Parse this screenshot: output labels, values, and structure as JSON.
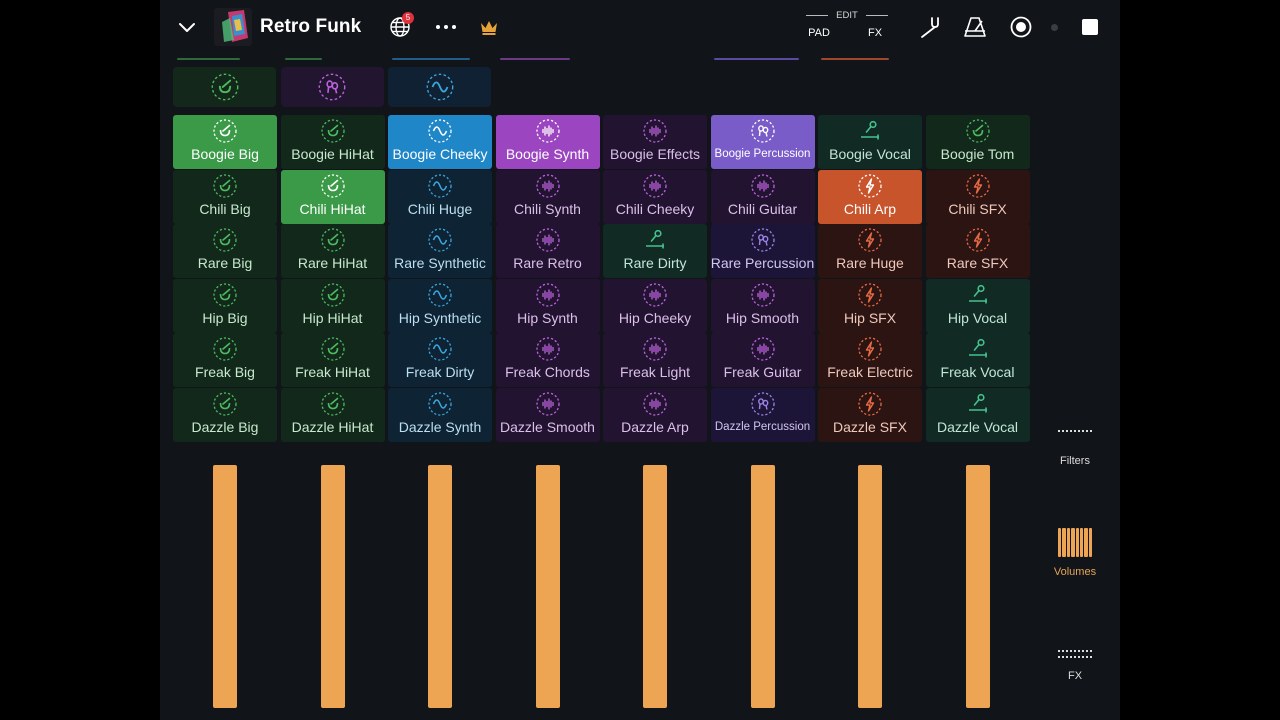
{
  "header": {
    "project_title": "Retro Funk",
    "notification_count": "5",
    "edit_label": "EDIT",
    "pad_label": "PAD",
    "fx_label": "FX"
  },
  "icons": {
    "back": "chevron-down-icon",
    "globe": "globe-icon",
    "more": "ellipsis-icon",
    "crown": "crown-icon",
    "tuner": "tuning-fork-icon",
    "metronome": "metronome-icon",
    "record": "record-icon",
    "stop": "stop-icon"
  },
  "colors": {
    "green": "#3a9a48",
    "blue": "#1f86c8",
    "purple": "#9b45c0",
    "violet": "#7a5cc8",
    "orange": "#c8542c",
    "teal": "#3aa17a",
    "fader": "#eda554"
  },
  "scene_icons": [
    "drum-icon",
    "percussion-icon",
    "wave-icon"
  ],
  "grid": {
    "rows": [
      [
        {
          "label": "Boogie Big",
          "icon": "drum-icon",
          "color": "green",
          "active": true
        },
        {
          "label": "Boogie HiHat",
          "icon": "drum-icon",
          "color": "green",
          "active": false
        },
        {
          "label": "Boogie Cheeky",
          "icon": "wave-icon",
          "color": "blue",
          "active": true
        },
        {
          "label": "Boogie Synth",
          "icon": "waveform-icon",
          "color": "purple",
          "active": true
        },
        {
          "label": "Boogie Effects",
          "icon": "waveform-icon",
          "color": "purple",
          "active": false
        },
        {
          "label": "Boogie Percussion",
          "icon": "percussion-icon",
          "color": "violet",
          "active": true
        },
        {
          "label": "Boogie Vocal",
          "icon": "mic-icon",
          "color": "teal",
          "active": false
        },
        {
          "label": "Boogie Tom",
          "icon": "drum-icon",
          "color": "green",
          "active": false
        }
      ],
      [
        {
          "label": "Chili Big",
          "icon": "drum-icon",
          "color": "green",
          "active": false
        },
        {
          "label": "Chili HiHat",
          "icon": "drum-icon",
          "color": "green",
          "active": true
        },
        {
          "label": "Chili Huge",
          "icon": "wave-icon",
          "color": "blue",
          "active": false
        },
        {
          "label": "Chili Synth",
          "icon": "waveform-icon",
          "color": "purple",
          "active": false
        },
        {
          "label": "Chili Cheeky",
          "icon": "waveform-icon",
          "color": "purple",
          "active": false
        },
        {
          "label": "Chili Guitar",
          "icon": "waveform-icon",
          "color": "purple",
          "active": false
        },
        {
          "label": "Chili Arp",
          "icon": "bolt-icon",
          "color": "orange",
          "active": true
        },
        {
          "label": "Chili SFX",
          "icon": "bolt-icon",
          "color": "orange",
          "active": false
        }
      ],
      [
        {
          "label": "Rare Big",
          "icon": "drum-icon",
          "color": "green",
          "active": false
        },
        {
          "label": "Rare HiHat",
          "icon": "drum-icon",
          "color": "green",
          "active": false
        },
        {
          "label": "Rare Synthetic",
          "icon": "wave-icon",
          "color": "blue",
          "active": false
        },
        {
          "label": "Rare Retro",
          "icon": "waveform-icon",
          "color": "purple",
          "active": false
        },
        {
          "label": "Rare Dirty",
          "icon": "mic-icon",
          "color": "teal",
          "active": false
        },
        {
          "label": "Rare Percussion",
          "icon": "percussion-icon",
          "color": "violet",
          "active": false
        },
        {
          "label": "Rare Huge",
          "icon": "bolt-icon",
          "color": "orange",
          "active": false
        },
        {
          "label": "Rare SFX",
          "icon": "bolt-icon",
          "color": "orange",
          "active": false
        }
      ],
      [
        {
          "label": "Hip Big",
          "icon": "drum-icon",
          "color": "green",
          "active": false
        },
        {
          "label": "Hip HiHat",
          "icon": "drum-icon",
          "color": "green",
          "active": false
        },
        {
          "label": "Hip Synthetic",
          "icon": "wave-icon",
          "color": "blue",
          "active": false
        },
        {
          "label": "Hip Synth",
          "icon": "waveform-icon",
          "color": "purple",
          "active": false
        },
        {
          "label": "Hip Cheeky",
          "icon": "waveform-icon",
          "color": "purple",
          "active": false
        },
        {
          "label": "Hip Smooth",
          "icon": "waveform-icon",
          "color": "purple",
          "active": false
        },
        {
          "label": "Hip SFX",
          "icon": "bolt-icon",
          "color": "orange",
          "active": false
        },
        {
          "label": "Hip Vocal",
          "icon": "mic-icon",
          "color": "teal",
          "active": false
        }
      ],
      [
        {
          "label": "Freak Big",
          "icon": "drum-icon",
          "color": "green",
          "active": false
        },
        {
          "label": "Freak HiHat",
          "icon": "drum-icon",
          "color": "green",
          "active": false
        },
        {
          "label": "Freak Dirty",
          "icon": "wave-icon",
          "color": "blue",
          "active": false
        },
        {
          "label": "Freak Chords",
          "icon": "waveform-icon",
          "color": "purple",
          "active": false
        },
        {
          "label": "Freak Light",
          "icon": "waveform-icon",
          "color": "purple",
          "active": false
        },
        {
          "label": "Freak Guitar",
          "icon": "waveform-icon",
          "color": "purple",
          "active": false
        },
        {
          "label": "Freak Electric",
          "icon": "bolt-icon",
          "color": "orange",
          "active": false
        },
        {
          "label": "Freak Vocal",
          "icon": "mic-icon",
          "color": "teal",
          "active": false
        }
      ],
      [
        {
          "label": "Dazzle Big",
          "icon": "drum-icon",
          "color": "green",
          "active": false
        },
        {
          "label": "Dazzle HiHat",
          "icon": "drum-icon",
          "color": "green",
          "active": false
        },
        {
          "label": "Dazzle Synth",
          "icon": "wave-icon",
          "color": "blue",
          "active": false
        },
        {
          "label": "Dazzle Smooth",
          "icon": "waveform-icon",
          "color": "purple",
          "active": false
        },
        {
          "label": "Dazzle Arp",
          "icon": "waveform-icon",
          "color": "purple",
          "active": false
        },
        {
          "label": "Dazzle Percussion",
          "icon": "percussion-icon",
          "color": "violet",
          "active": false
        },
        {
          "label": "Dazzle SFX",
          "icon": "bolt-icon",
          "color": "orange",
          "active": false
        },
        {
          "label": "Dazzle Vocal",
          "icon": "mic-icon",
          "color": "teal",
          "active": false
        }
      ]
    ]
  },
  "faders": {
    "levels": [
      1,
      1,
      1,
      1,
      1,
      1,
      1,
      1
    ]
  },
  "side": {
    "filters_label": "Filters",
    "volumes_label": "Volumes",
    "fx_label": "FX"
  }
}
